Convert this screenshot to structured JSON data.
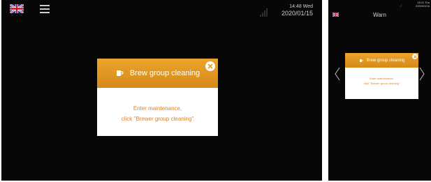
{
  "main": {
    "clock_time": "14:48 Wed",
    "clock_date": "2020/01/15",
    "dialog": {
      "title": "Brew group cleaning",
      "line1": "Enter maintenance,",
      "line2": "click \"Brewer group cleaning\""
    }
  },
  "side": {
    "header_title": "Warn",
    "clock_time": "15:11 Thu",
    "clock_date": "2020/01/16",
    "dialog": {
      "title": "Brew group cleaning",
      "line1": "Enter maintenance,",
      "line2": "click \"Brewer group cleaning\""
    }
  },
  "icons": [
    "uk-flag-icon",
    "hamburger-menu-icon",
    "signal-strength-icon",
    "cup-icon",
    "close-icon",
    "chevron-left-icon",
    "chevron-right-icon"
  ],
  "colors": {
    "background": "#070707",
    "dialog_header": "#e39a24",
    "dialog_text": "#d9822b",
    "dialog_body": "#ffffff"
  }
}
